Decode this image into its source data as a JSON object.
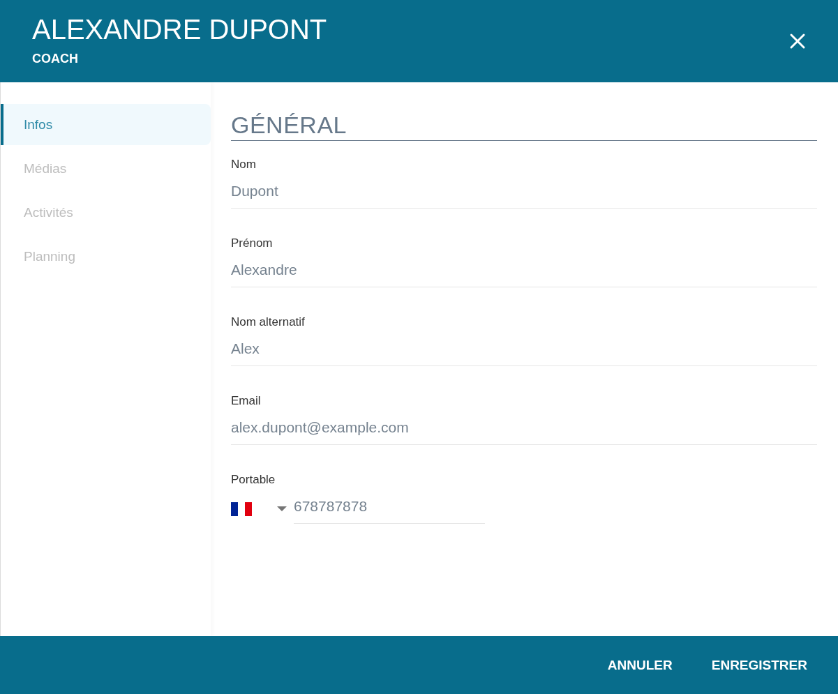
{
  "header": {
    "title": "ALEXANDRE DUPONT",
    "subtitle": "COACH"
  },
  "sidebar": {
    "items": [
      {
        "label": "Infos",
        "selected": true
      },
      {
        "label": "Médias",
        "selected": false
      },
      {
        "label": "Activités",
        "selected": false
      },
      {
        "label": "Planning",
        "selected": false
      }
    ]
  },
  "section": {
    "title": "GÉNÉRAL"
  },
  "fields": [
    {
      "kind": "text",
      "label": "Nom",
      "value": "Dupont"
    },
    {
      "kind": "text",
      "label": "Prénom",
      "value": "Alexandre"
    },
    {
      "kind": "text",
      "label": "Nom alternatif",
      "value": "Alex"
    },
    {
      "kind": "text",
      "label": "Email",
      "value": "alex.dupont@example.com"
    },
    {
      "kind": "phone",
      "label": "Portable",
      "value": "678787878"
    }
  ],
  "footer": {
    "buttons": [
      "ANNULER",
      "ENREGISTRER"
    ]
  }
}
